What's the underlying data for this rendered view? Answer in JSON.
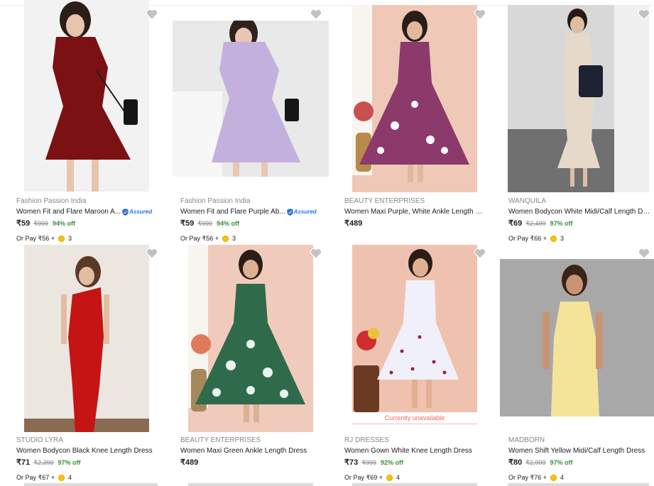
{
  "products": [
    {
      "brand": "Fashion Passion India",
      "title": "Women Fit and Flare Maroon A...",
      "assured": true,
      "assured_label": "Assured",
      "price": "₹59",
      "mrp": "₹999",
      "discount": "94% off",
      "orpay_label": "Or Pay ₹56 +",
      "coins": "3",
      "unavailable": "",
      "dress_color": "#7b1113",
      "bg_color": "#f2f2f2"
    },
    {
      "brand": "Fashion Passion India",
      "title": "Women Fit and Flare Purple Ab...",
      "assured": true,
      "assured_label": "Assured",
      "price": "₹59",
      "mrp": "₹999",
      "discount": "94% off",
      "orpay_label": "Or Pay ₹56 +",
      "coins": "3",
      "unavailable": "",
      "dress_color": "#c4b0dd",
      "bg_color": "#e9e9e9"
    },
    {
      "brand": "BEAUTY ENTERPRISES",
      "title": "Women Maxi Purple, White Ankle Length Dr...",
      "assured": false,
      "assured_label": "",
      "price": "₹489",
      "mrp": "",
      "discount": "",
      "orpay_label": "",
      "coins": "",
      "unavailable": "",
      "dress_color": "#8b3a6b",
      "bg_color": "#f0c8b8"
    },
    {
      "brand": "WANQUILA",
      "title": "Women Bodycon White Midi/Calf Length Dr...",
      "assured": false,
      "assured_label": "",
      "price": "₹69",
      "mrp": "₹2,499",
      "discount": "97% off",
      "orpay_label": "Or Pay ₹66 +",
      "coins": "3",
      "unavailable": "",
      "dress_color": "#e6d9c9",
      "bg_color": "#d8d8d8"
    },
    {
      "brand": "STUDIO LYRA",
      "title": "Women Bodycon Black Knee Length Dress",
      "assured": false,
      "assured_label": "",
      "price": "₹71",
      "mrp": "₹2,399",
      "discount": "97% off",
      "orpay_label": "Or Pay ₹67 +",
      "coins": "4",
      "unavailable": "",
      "dress_color": "#c41414",
      "bg_color": "#ebe6e0"
    },
    {
      "brand": "BEAUTY ENTERPRISES",
      "title": "Women Maxi Green Ankle Length Dress",
      "assured": false,
      "assured_label": "",
      "price": "₹489",
      "mrp": "",
      "discount": "",
      "orpay_label": "",
      "coins": "",
      "unavailable": "",
      "dress_color": "#2f6b4a",
      "bg_color": "#f0cbbb"
    },
    {
      "brand": "RJ DRESSES",
      "title": "Women Gown White Knee Length Dress",
      "assured": false,
      "assured_label": "",
      "price": "₹73",
      "mrp": "₹999",
      "discount": "92% off",
      "orpay_label": "Or Pay ₹69 +",
      "coins": "4",
      "unavailable": "Currently unavailable",
      "dress_color": "#f0f0fa",
      "bg_color": "#efc2b0"
    },
    {
      "brand": "MADBORN",
      "title": "Women Shift Yellow Midi/Calf Length Dress",
      "assured": false,
      "assured_label": "",
      "price": "₹80",
      "mrp": "₹2,999",
      "discount": "97% off",
      "orpay_label": "Or Pay ₹76 +",
      "coins": "4",
      "unavailable": "",
      "dress_color": "#f3e49a",
      "bg_color": "#a8a8a8"
    }
  ]
}
